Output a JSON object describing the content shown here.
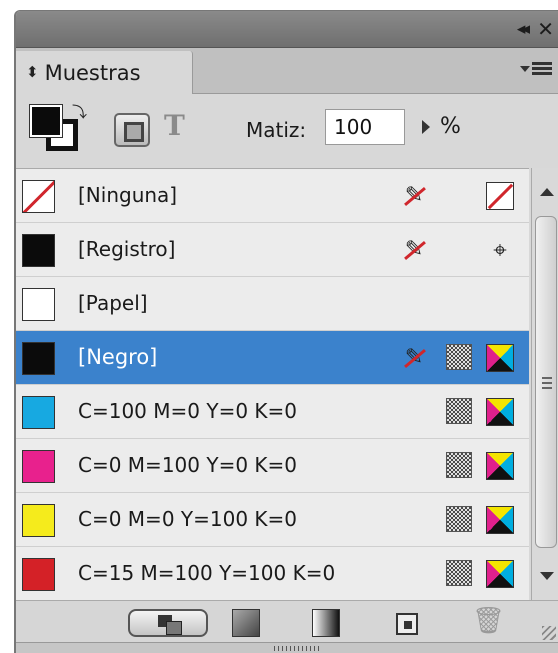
{
  "window": {
    "collapse_glyph": "◂◂",
    "close_glyph": "✕"
  },
  "panel": {
    "title": "Muestras"
  },
  "toolbar": {
    "tint_label": "Matiz:",
    "tint_value": "100",
    "tint_unit": "%",
    "text_format_glyph": "T"
  },
  "swatches": [
    {
      "name": "[Ninguna]",
      "color": "none",
      "icons": [
        "no-edit",
        "none-box"
      ]
    },
    {
      "name": "[Registro]",
      "color": "#0b0b0b",
      "icons": [
        "no-edit",
        "registration"
      ]
    },
    {
      "name": "[Papel]",
      "color": "#ffffff",
      "icons": []
    },
    {
      "name": "[Negro]",
      "color": "#0b0b0b",
      "selected": true,
      "icons": [
        "no-edit",
        "process",
        "cmyk"
      ]
    },
    {
      "name": "C=100 M=0 Y=0 K=0",
      "color": "#17a9e1",
      "icons": [
        "process",
        "cmyk"
      ]
    },
    {
      "name": "C=0 M=100 Y=0 K=0",
      "color": "#e8218d",
      "icons": [
        "process",
        "cmyk"
      ]
    },
    {
      "name": "C=0 M=0 Y=100 K=0",
      "color": "#f5eb1c",
      "icons": [
        "process",
        "cmyk"
      ]
    },
    {
      "name": "C=15 M=100 Y=100 K=0",
      "color": "#d42127",
      "icons": [
        "process",
        "cmyk"
      ]
    }
  ],
  "glyphs": {
    "no_edit": "✎",
    "registration": "⌖",
    "trash": "🗑"
  }
}
